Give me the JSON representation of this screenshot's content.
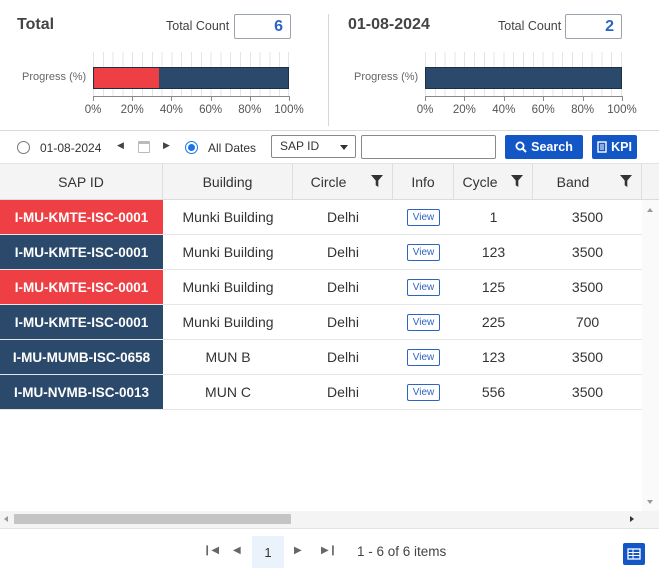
{
  "summary": {
    "left": {
      "title": "Total",
      "total_count_label": "Total Count",
      "total_count": "6",
      "progress_label": "Progress (%)",
      "progress_fraction_red": 0.333
    },
    "right": {
      "title": "01-08-2024",
      "total_count_label": "Total Count",
      "total_count": "2",
      "progress_label": "Progress (%)",
      "progress_fraction_red": 0
    },
    "ticks": [
      "0%",
      "20%",
      "40%",
      "60%",
      "80%",
      "100%"
    ],
    "colors": {
      "red": "#ee3f45",
      "navy": "#2b4a6b"
    }
  },
  "filter": {
    "date_option": "01-08-2024",
    "all_dates_option": "All Dates",
    "selected_option": "All Dates",
    "field_select": "SAP ID",
    "search_value": "",
    "search_button": "Search",
    "kpi_button": "KPI"
  },
  "grid": {
    "columns": [
      "SAP ID",
      "Building",
      "Circle",
      "Info",
      "Cycle",
      "Band"
    ],
    "rows": [
      {
        "sap_id": "I-MU-KMTE-ISC-0001",
        "building": "Munki Building",
        "circle": "Delhi",
        "info": "View",
        "cycle": "1",
        "band": "3500",
        "status": "red"
      },
      {
        "sap_id": "I-MU-KMTE-ISC-0001",
        "building": "Munki Building",
        "circle": "Delhi",
        "info": "View",
        "cycle": "123",
        "band": "3500",
        "status": "navy"
      },
      {
        "sap_id": "I-MU-KMTE-ISC-0001",
        "building": "Munki Building",
        "circle": "Delhi",
        "info": "View",
        "cycle": "125",
        "band": "3500",
        "status": "red"
      },
      {
        "sap_id": "I-MU-KMTE-ISC-0001",
        "building": "Munki Building",
        "circle": "Delhi",
        "info": "View",
        "cycle": "225",
        "band": "700",
        "status": "navy"
      },
      {
        "sap_id": "I-MU-MUMB-ISC-0658",
        "building": "MUN B",
        "circle": "Delhi",
        "info": "View",
        "cycle": "123",
        "band": "3500",
        "status": "navy"
      },
      {
        "sap_id": "I-MU-NVMB-ISC-0013",
        "building": "MUN C",
        "circle": "Delhi",
        "info": "View",
        "cycle": "556",
        "band": "3500",
        "status": "navy"
      }
    ]
  },
  "pager": {
    "current_page": "1",
    "info": "1 - 6 of 6 items"
  }
}
